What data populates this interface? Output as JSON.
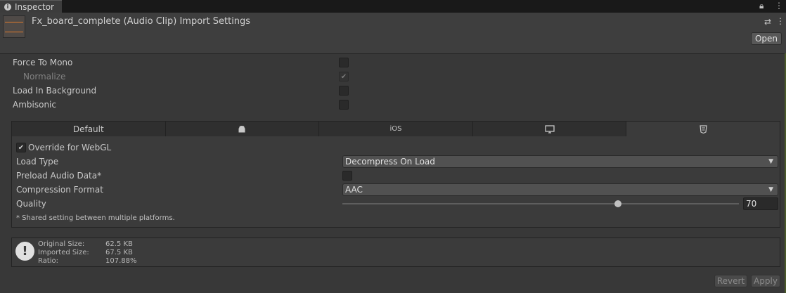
{
  "window": {
    "tab_label": "Inspector",
    "tab_icon": "info-icon",
    "lock_icon": "lock-icon",
    "menu_icon": "kebab-menu-icon"
  },
  "header": {
    "title": "Fx_board_complete (Audio Clip) Import Settings",
    "presets_icon": "sliders-icon",
    "menu_icon": "kebab-menu-icon",
    "open_label": "Open"
  },
  "settings": {
    "force_to_mono": {
      "label": "Force To Mono",
      "checked": false
    },
    "normalize": {
      "label": "Normalize",
      "checked": true,
      "disabled": true
    },
    "load_in_background": {
      "label": "Load In Background",
      "checked": false
    },
    "ambisonic": {
      "label": "Ambisonic",
      "checked": false
    }
  },
  "platform_tabs": [
    {
      "label": "Default",
      "icon": ""
    },
    {
      "label": "",
      "icon": "android-icon"
    },
    {
      "label": "iOS",
      "icon": ""
    },
    {
      "label": "",
      "icon": "desktop-icon"
    },
    {
      "label": "",
      "icon": "webgl-html5-icon",
      "active": true
    }
  ],
  "webgl": {
    "override": {
      "label": "Override for WebGL",
      "checked": true
    },
    "load_type": {
      "label": "Load Type",
      "value": "Decompress On Load"
    },
    "preload": {
      "label": "Preload Audio Data*",
      "checked": false
    },
    "compression": {
      "label": "Compression Format",
      "value": "AAC"
    },
    "quality": {
      "label": "Quality",
      "value": "70",
      "slider_fraction": 0.7
    },
    "note": "* Shared setting between multiple platforms."
  },
  "info": {
    "icon": "warning-icon",
    "rows": [
      {
        "label": "Original Size:",
        "value": "62.5 KB"
      },
      {
        "label": "Imported Size:",
        "value": "67.5 KB"
      },
      {
        "label": "Ratio:",
        "value": "107.88%"
      }
    ]
  },
  "footer": {
    "revert_label": "Revert",
    "apply_label": "Apply"
  },
  "colors": {
    "background": "#383838",
    "tab_bar": "#191919",
    "thumbnail_wave": "#e07a2c"
  }
}
